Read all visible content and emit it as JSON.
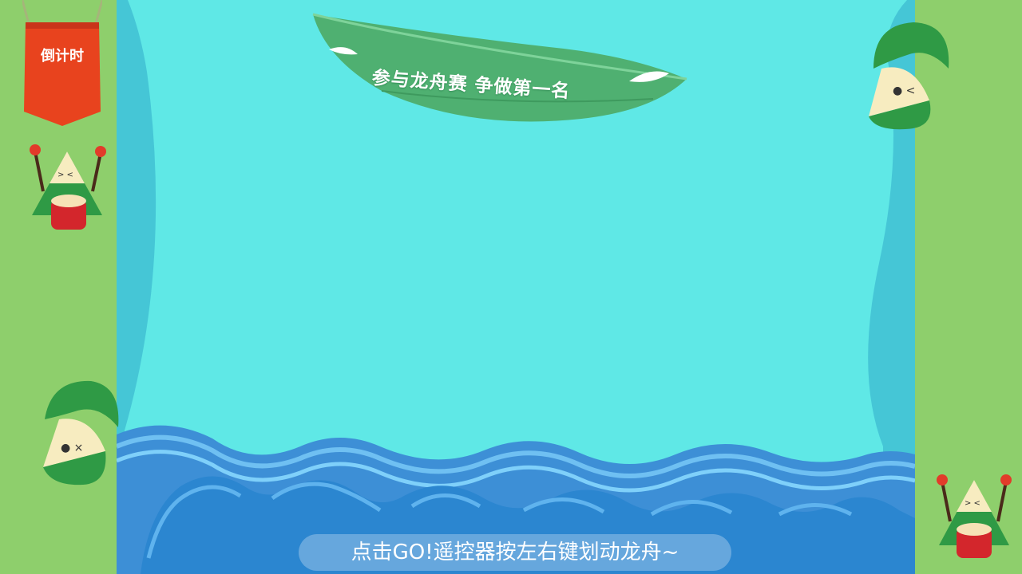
{
  "countdown": {
    "label": "倒计时"
  },
  "title": {
    "text": "参与龙舟赛 争做第一名"
  },
  "hint": {
    "text": "点击GO!遥控器按左右键划动龙舟~"
  },
  "colors": {
    "side_green": "#8ecf6c",
    "water": "#5fe8e6",
    "banner_red": "#e8431e",
    "leaf_green": "#4fb071",
    "wave_blue": "#2b86d0"
  }
}
